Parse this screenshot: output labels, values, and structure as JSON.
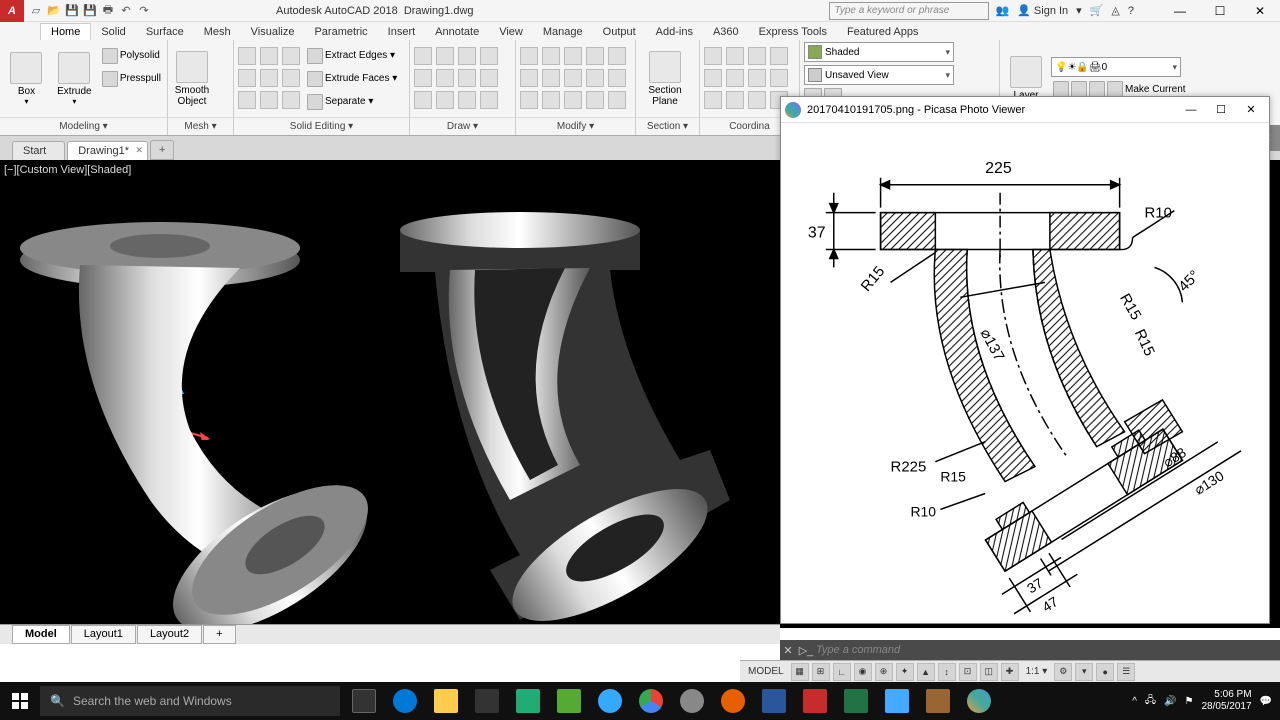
{
  "title": {
    "app": "Autodesk AutoCAD 2018",
    "doc": "Drawing1.dwg"
  },
  "search": {
    "placeholder": "Type a keyword or phrase"
  },
  "user": {
    "signin": "Sign In"
  },
  "menubar": [
    "Home",
    "Solid",
    "Surface",
    "Mesh",
    "Visualize",
    "Parametric",
    "Insert",
    "Annotate",
    "View",
    "Manage",
    "Output",
    "Add-ins",
    "A360",
    "Express Tools",
    "Featured Apps"
  ],
  "ribbon": {
    "modeling": {
      "label": "Modeling ▾",
      "box": "Box",
      "extrude": "Extrude",
      "polysolid": "Polysolid",
      "presspull": "Presspull"
    },
    "mesh": {
      "label": "Mesh ▾",
      "smooth": "Smooth\nObject"
    },
    "solidedit": {
      "label": "Solid Editing ▾",
      "extractedges": "Extract Edges ▾",
      "extrudefaces": "Extrude Faces ▾",
      "separate": "Separate ▾"
    },
    "draw": {
      "label": "Draw ▾"
    },
    "modify": {
      "label": "Modify ▾"
    },
    "section": {
      "label": "Section ▾",
      "plane": "Section\nPlane"
    },
    "coord": {
      "label": "Coordina"
    },
    "view": {
      "shaded": "Shaded",
      "unsaved": "Unsaved View"
    },
    "layers": {
      "label": "Layer",
      "current": "0",
      "makecur": "Make Current"
    }
  },
  "doctabs": {
    "start": "Start",
    "drawing": "Drawing1*",
    "add": "+"
  },
  "viewport": {
    "label": "[−][Custom View][Shaded]"
  },
  "picasa": {
    "title": "20170410191705.png - Picasa Photo Viewer"
  },
  "drawing_dims": {
    "top": "225",
    "left": "37",
    "r10a": "R10",
    "r15a": "R15",
    "r15b": "R15",
    "r15c": "R15",
    "dia137": "⌀137",
    "ang45": "45°",
    "r225": "R225",
    "r15d": "R15",
    "r10b": "R10",
    "d37": "37",
    "d47": "47",
    "dia88": "⌀88",
    "dia130": "⌀130"
  },
  "layout_tabs": {
    "model": "Model",
    "l1": "Layout1",
    "l2": "Layout2",
    "add": "+"
  },
  "cmdline": {
    "placeholder": "Type a command"
  },
  "status": {
    "model": "MODEL",
    "scale": "1:1 ▾"
  },
  "taskbar": {
    "search": "Search the web and Windows",
    "time": "5:06 PM",
    "date": "28/05/2017"
  }
}
